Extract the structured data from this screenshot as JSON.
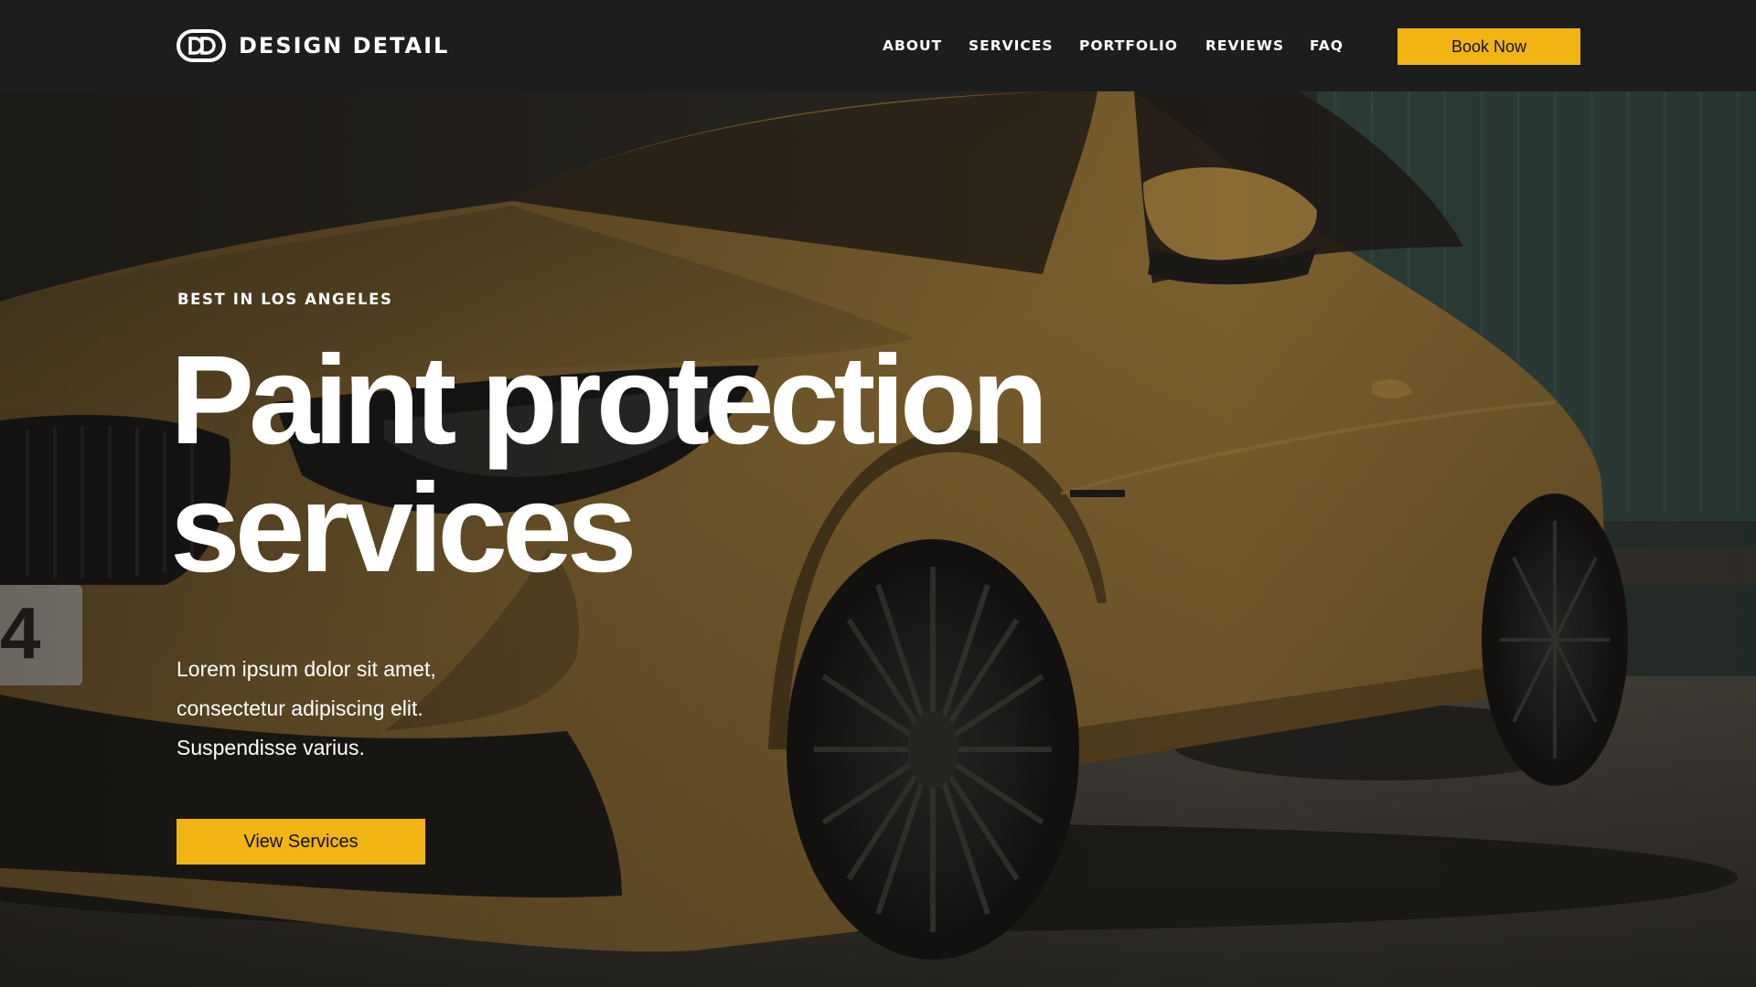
{
  "header": {
    "brand": "DESIGN DETAIL",
    "nav": [
      {
        "label": "ABOUT"
      },
      {
        "label": "SERVICES"
      },
      {
        "label": "PORTFOLIO"
      },
      {
        "label": "REVIEWS"
      },
      {
        "label": "FAQ"
      }
    ],
    "cta_label": "Book Now"
  },
  "hero": {
    "eyebrow": "BEST IN LOS ANGELES",
    "headline": [
      "Paint protection",
      "services"
    ],
    "lead_lines": [
      "Lorem ipsum dolor sit amet,",
      "consectetur adipiscing elit.",
      "Suspendisse varius."
    ],
    "cta_label": "View Services",
    "background_photo": "mustard yellow sports car parked beside a building"
  },
  "colors": {
    "accent": "#f1b412",
    "header_bg": "#1d1d1d",
    "text_light": "#ffffff",
    "button_text": "#111111"
  }
}
